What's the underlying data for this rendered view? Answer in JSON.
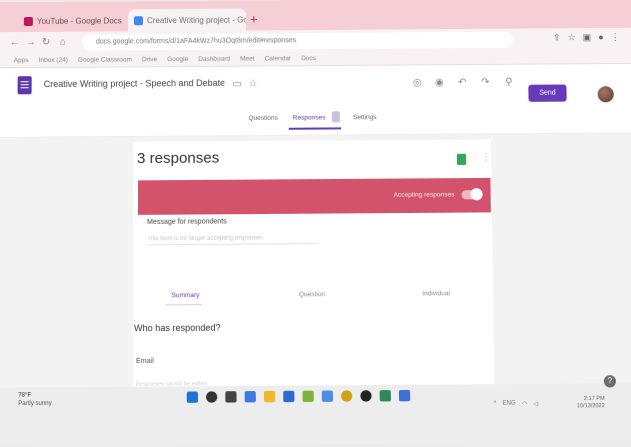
{
  "browser": {
    "tabs": [
      {
        "label": "YouTube - Google Docs",
        "color": "#c2185b"
      },
      {
        "label": "Creative Writing project - Google Forms",
        "color": "#4285f4"
      }
    ],
    "new_tab": "+",
    "address": "docs.google.com/forms/d/1aFA4kWz7hu3Oqt8m/edit#responses",
    "bookmarks": [
      "Apps",
      "Inbox (24)",
      "Google Classroom",
      "Drive",
      "Google",
      "Dashboard",
      "Meet",
      "Calendar",
      "Docs"
    ]
  },
  "header": {
    "title": "Creative Writing project - Speech and Debate",
    "send_label": "Send"
  },
  "subtabs": {
    "questions": "Questions",
    "responses": "Responses",
    "settings": "Settings"
  },
  "responses": {
    "count_label": "3 responses",
    "accepting_label": "Accepting responses",
    "message_label": "Message for respondents",
    "message_placeholder": "This form is no longer accepting responses",
    "tabs": {
      "summary": "Summary",
      "question": "Question",
      "individual": "Individual"
    },
    "who_title": "Who has responded?",
    "email_label": "Email",
    "email_sub": "Responses cannot be edited"
  },
  "taskbar": {
    "weather_temp": "78°F",
    "weather_desc": "Partly sunny",
    "tray": "ENG",
    "time": "2:17 PM",
    "date": "10/13/2022"
  },
  "colors": {
    "accent": "#673ab7",
    "banner": "#d2536b",
    "tab_strip": "#f6cfd6"
  }
}
